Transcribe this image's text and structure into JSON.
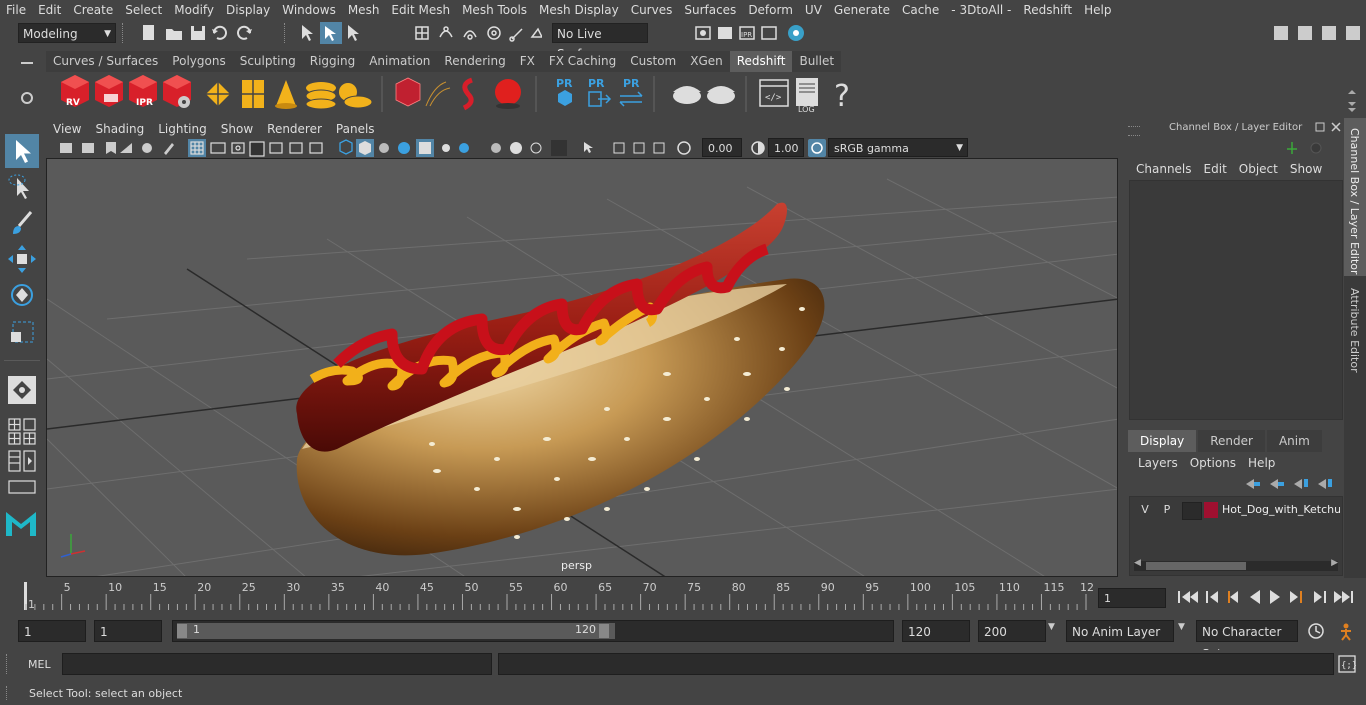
{
  "menubar": {
    "items": [
      "File",
      "Edit",
      "Create",
      "Select",
      "Modify",
      "Display",
      "Windows",
      "Mesh",
      "Edit Mesh",
      "Mesh Tools",
      "Mesh Display",
      "Curves",
      "Surfaces",
      "Deform",
      "UV",
      "Generate",
      "Cache",
      "- 3DtoAll -",
      "Redshift",
      "Help"
    ]
  },
  "statusline": {
    "mode": "Modeling",
    "live_surface": "No Live Surface"
  },
  "shelf": {
    "tabs": [
      "Curves / Surfaces",
      "Polygons",
      "Sculpting",
      "Rigging",
      "Animation",
      "Rendering",
      "FX",
      "FX Caching",
      "Custom",
      "XGen",
      "Redshift",
      "Bullet"
    ],
    "active_tab": "Redshift",
    "icon_labels": {
      "rv": "RV",
      "ipr": "IPR",
      "pr": "PR",
      "log": "LOG",
      "help": "?"
    }
  },
  "viewport": {
    "menus": [
      "View",
      "Shading",
      "Lighting",
      "Show",
      "Renderer",
      "Panels"
    ],
    "exposure": "0.00",
    "gamma": "1.00",
    "color_space": "sRGB gamma",
    "camera_label": "persp"
  },
  "channel_box": {
    "title": "Channel Box / Layer Editor",
    "menus": [
      "Channels",
      "Edit",
      "Object",
      "Show"
    ]
  },
  "layer_editor": {
    "tabs": [
      "Display",
      "Render",
      "Anim"
    ],
    "active_tab": "Display",
    "menus": [
      "Layers",
      "Options",
      "Help"
    ],
    "layer": {
      "v": "V",
      "p": "P",
      "name": "Hot_Dog_with_Ketchu",
      "color": "#a01030"
    }
  },
  "side_tabs": [
    "Channel Box / Layer Editor",
    "Attribute Editor"
  ],
  "timeline": {
    "ticks": [
      "1",
      "5",
      "10",
      "15",
      "20",
      "25",
      "30",
      "35",
      "40",
      "45",
      "50",
      "55",
      "60",
      "65",
      "70",
      "75",
      "80",
      "85",
      "90",
      "95",
      "100",
      "105",
      "110",
      "115",
      "12"
    ],
    "current_frame": "1"
  },
  "range": {
    "start": "1",
    "playback_start": "1",
    "slider_start": "1",
    "slider_end": "120",
    "playback_end": "120",
    "end": "200",
    "anim_layer": "No Anim Layer",
    "character_set": "No Character Set"
  },
  "command_line": {
    "label": "MEL"
  },
  "help_line": {
    "text": "Select Tool: select an object"
  }
}
